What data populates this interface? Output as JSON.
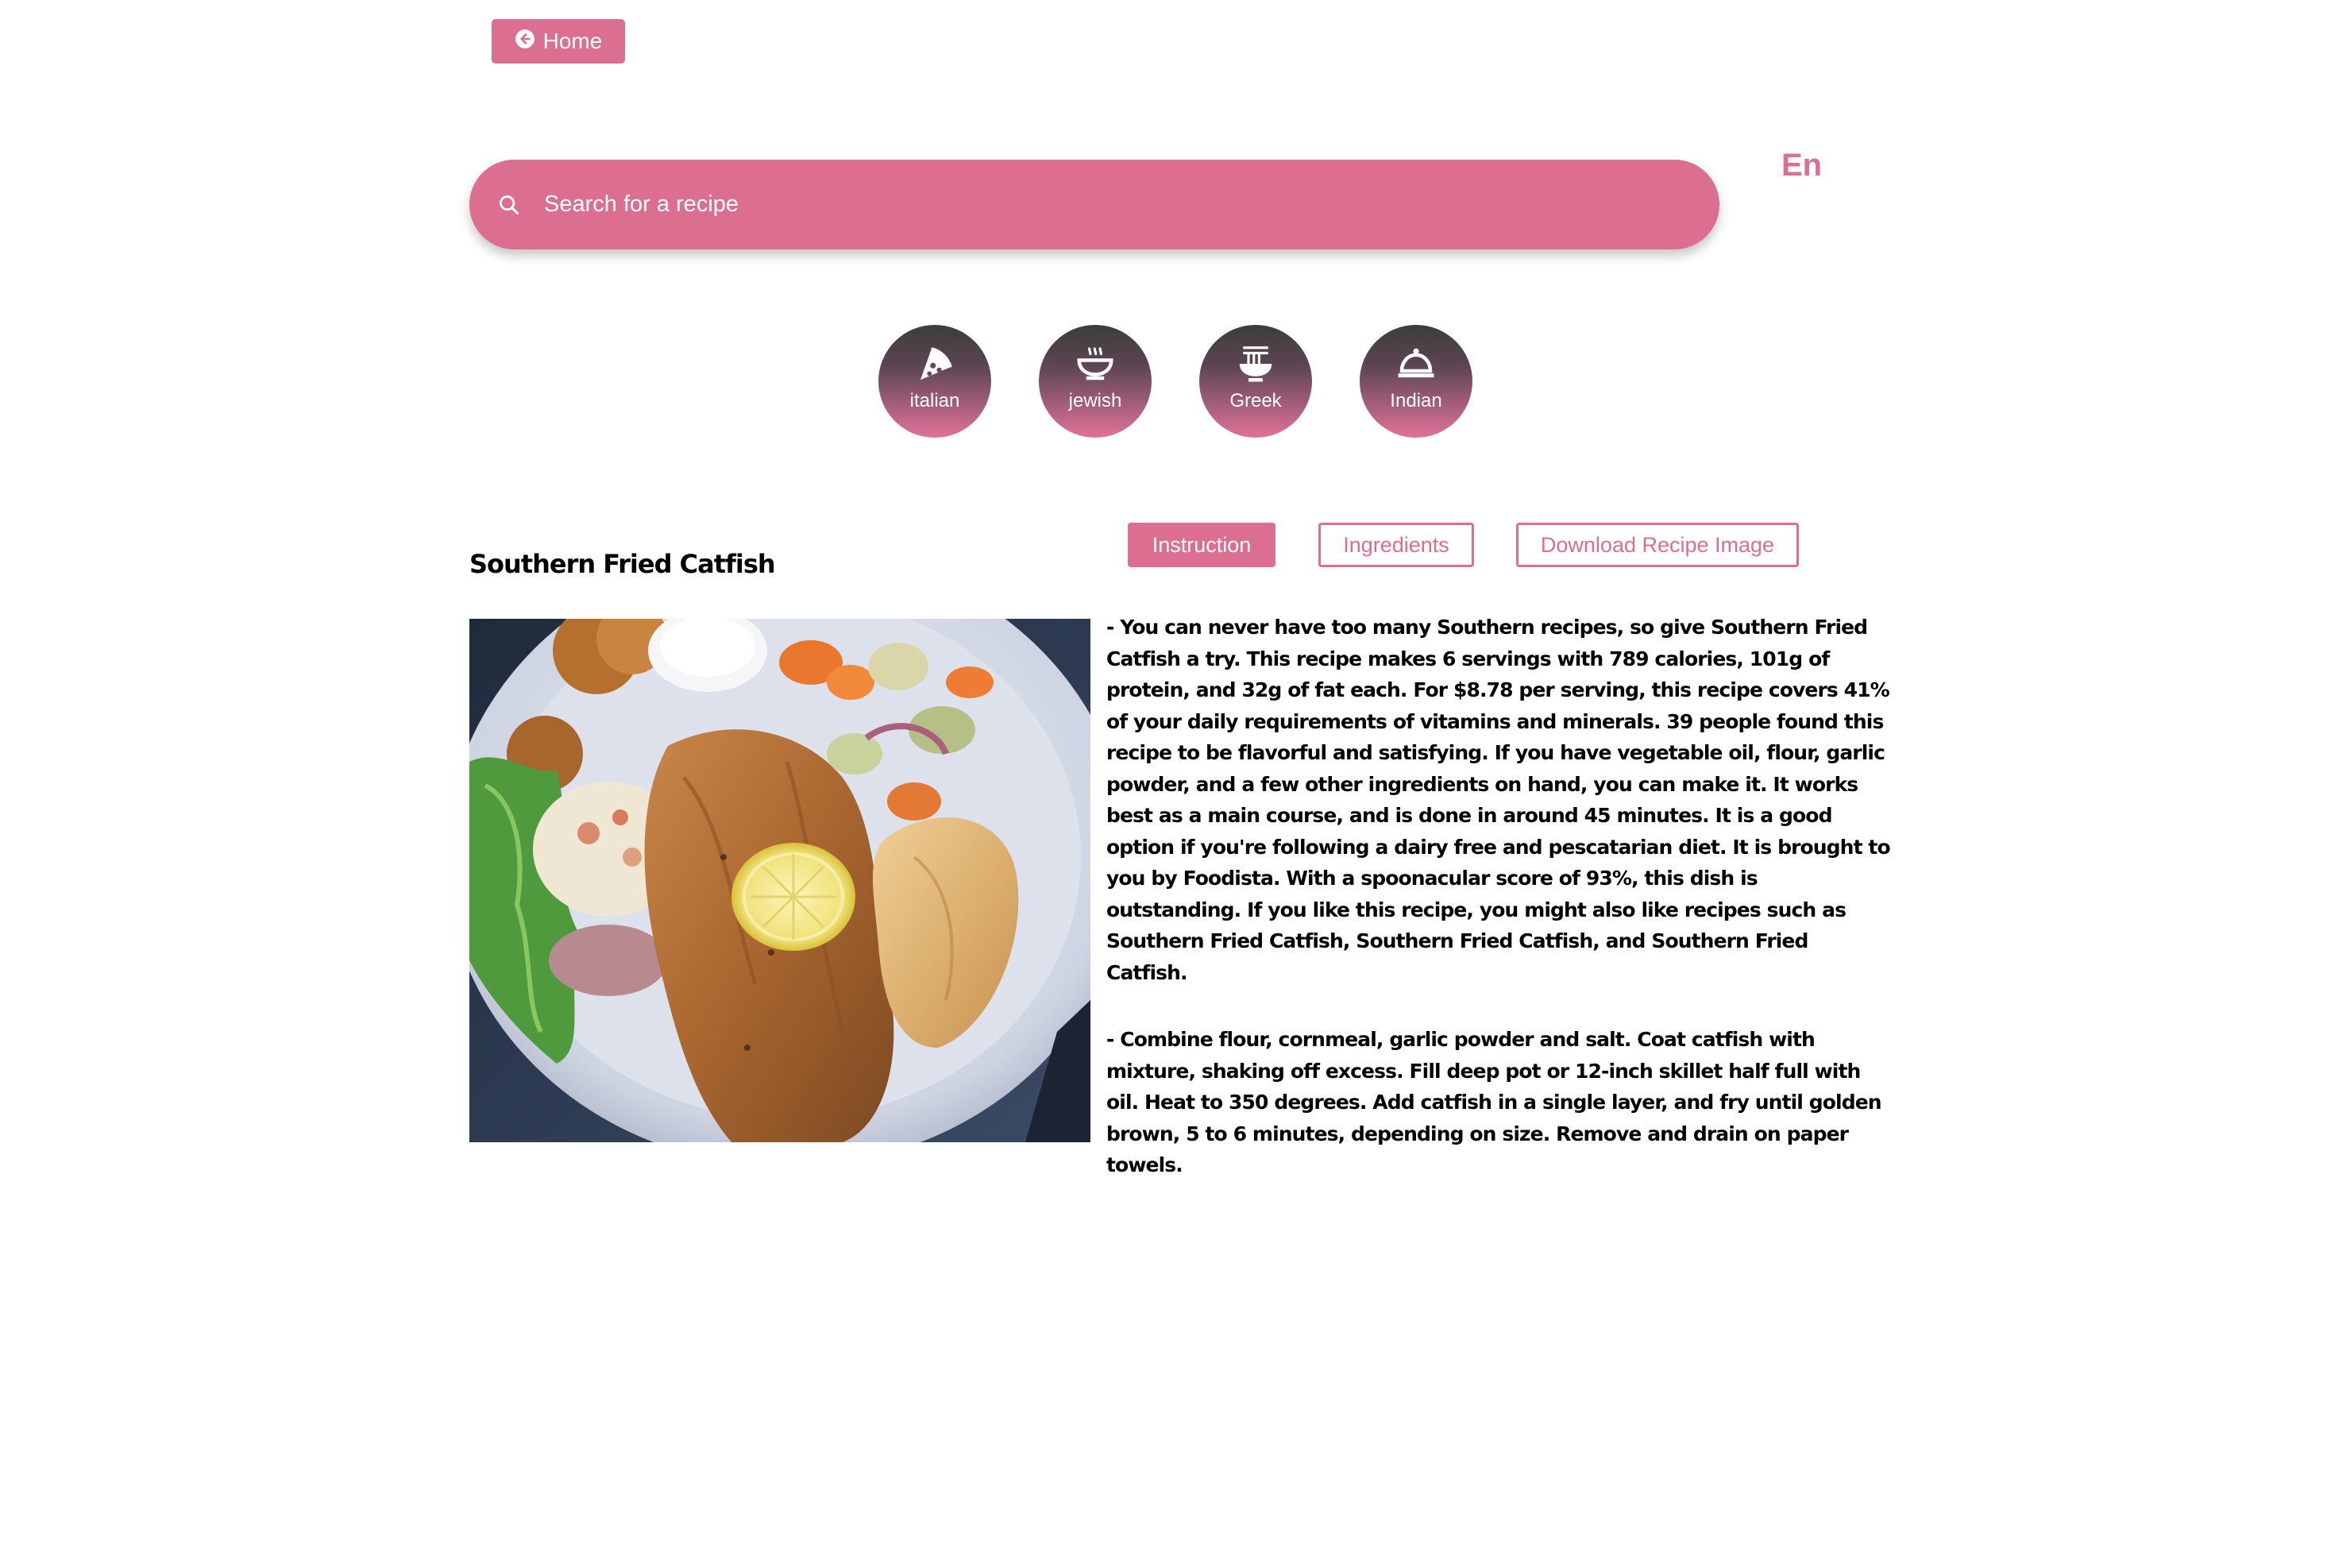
{
  "nav": {
    "home_label": "Home",
    "home_icon": "arrow-left-circle-icon"
  },
  "search": {
    "placeholder": "Search for a recipe",
    "icon": "search-icon"
  },
  "language": {
    "label": "En"
  },
  "categories": [
    {
      "label": "italian",
      "icon": "pizza-icon"
    },
    {
      "label": "jewish",
      "icon": "bowl-icon"
    },
    {
      "label": "Greek",
      "icon": "noodles-icon"
    },
    {
      "label": "Indian",
      "icon": "cloche-icon"
    }
  ],
  "tabs": [
    {
      "label": "Instruction",
      "active": true
    },
    {
      "label": "Ingredients",
      "active": false
    },
    {
      "label": "Download Recipe Image",
      "active": false
    }
  ],
  "recipe": {
    "title": "Southern Fried Catfish",
    "summary": "- You can never have too many Southern recipes, so give Southern Fried Catfish a try. This recipe makes 6 servings with 789 calories, 101g of protein, and 32g of fat each. For $8.78 per serving, this recipe covers 41% of your daily requirements of vitamins and minerals. 39 people found this recipe to be flavorful and satisfying. If you have vegetable oil, flour, garlic powder, and a few other ingredients on hand, you can make it. It works best as a main course, and is done in around 45 minutes. It is a good option if you're following a dairy free and pescatarian diet. It is brought to you by Foodista. With a spoonacular score of 93%, this dish is outstanding. If you like this recipe, you might also like recipes such as Southern Fried Catfish, Southern Fried Catfish, and Southern Fried Catfish.",
    "instructions": "- Combine flour, cornmeal, garlic powder and salt. Coat catfish with mixture, shaking off excess. Fill deep pot or 12-inch skillet half full with oil. Heat to 350 degrees. Add catfish in a single layer, and fry until golden brown, 5 to 6 minutes, depending on size. Remove and drain on paper towels."
  },
  "colors": {
    "accent": "#dc6e90",
    "text": "#000000",
    "background": "#ffffff"
  }
}
